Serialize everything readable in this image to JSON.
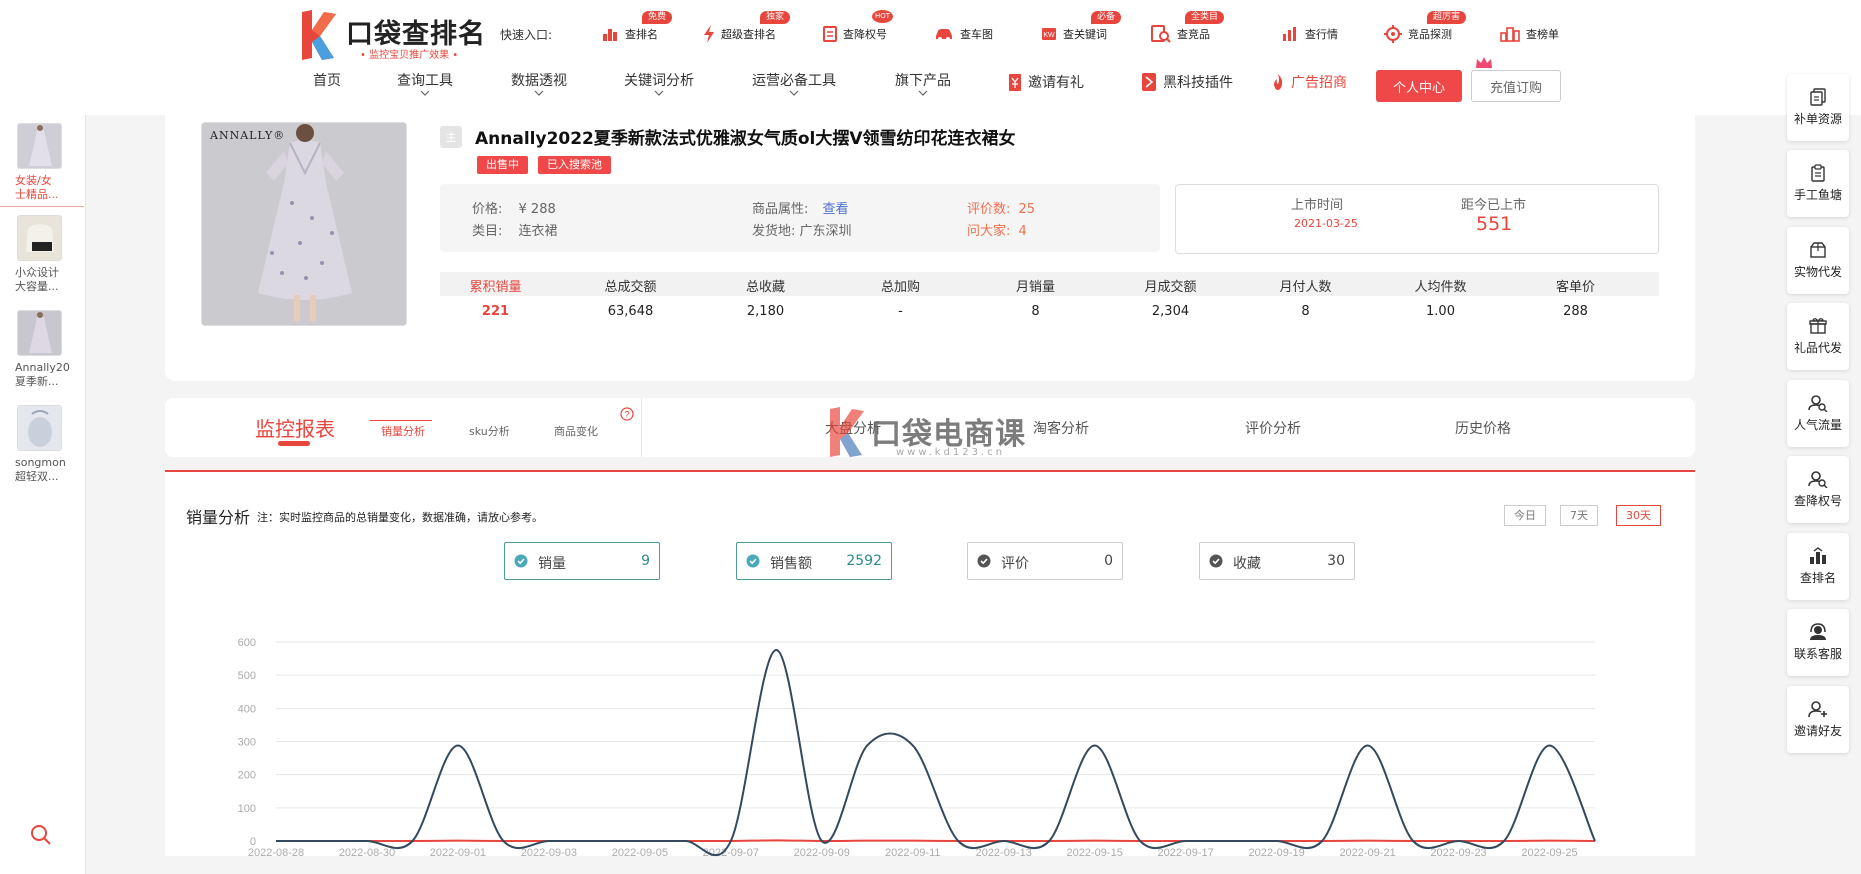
{
  "header": {
    "logo_title": "口袋查排名",
    "logo_subtitle": "• 监控宝贝推广效果 •",
    "quick_entry_label": "快速入口:",
    "quick_links": [
      {
        "label": "查排名",
        "tag": "免费",
        "icon": "rank-icon"
      },
      {
        "label": "超级查排名",
        "tag": "独家",
        "icon": "lightning-icon"
      },
      {
        "label": "查降权号",
        "tag": "HOT",
        "icon": "document-icon"
      },
      {
        "label": "查车图",
        "tag": "",
        "icon": "car-icon"
      },
      {
        "label": "查关键词",
        "tag": "必备",
        "icon": "keyword-icon"
      },
      {
        "label": "查竞品",
        "tag": "全类目",
        "icon": "search-document-icon"
      },
      {
        "label": "查行情",
        "tag": "",
        "icon": "bar-chart-icon"
      },
      {
        "label": "竞品探测",
        "tag": "超厉害",
        "icon": "target-icon"
      },
      {
        "label": "查榜单",
        "tag": "",
        "icon": "ranking-board-icon"
      }
    ],
    "nav": [
      "首页",
      "查询工具",
      "数据透视",
      "关键词分析",
      "运营必备工具",
      "旗下产品"
    ],
    "nav_special": [
      {
        "label": "邀请有礼",
        "icon": "gift-tag-icon",
        "color": "#333333"
      },
      {
        "label": "黑科技插件",
        "icon": "plugin-icon",
        "color": "#333333"
      },
      {
        "label": "广告招商",
        "icon": "ad-flame-icon",
        "color": "#e8453c"
      }
    ],
    "personal_center": "个人中心",
    "recharge": "充值订购"
  },
  "left_sidebar": {
    "items": [
      {
        "text": "女装/女士精品...",
        "line1": "女装/女",
        "line2": "士精品...",
        "active": true
      },
      {
        "text": "小众设计大容量...",
        "line1": "小众设计",
        "line2": "大容量...",
        "active": false
      },
      {
        "text": "Annally2022夏季新...",
        "line1": "Annally20",
        "line2": "夏季新...",
        "active": false
      },
      {
        "text": "songmont超轻双...",
        "line1": "songmon",
        "line2": "超轻双...",
        "active": false
      }
    ]
  },
  "right_sidebar": {
    "items": [
      {
        "label": "补单资源",
        "icon": "copy-icon"
      },
      {
        "label": "手工鱼塘",
        "icon": "clipboard-icon"
      },
      {
        "label": "实物代发",
        "icon": "package-icon"
      },
      {
        "label": "礼品代发",
        "icon": "gift-icon"
      },
      {
        "label": "人气流量",
        "icon": "user-search-icon"
      },
      {
        "label": "查降权号",
        "icon": "user-search-icon"
      },
      {
        "label": "查排名",
        "icon": "rank-icon"
      },
      {
        "label": "联系客服",
        "icon": "headset-icon"
      },
      {
        "label": "邀请好友",
        "icon": "add-user-icon"
      }
    ]
  },
  "product": {
    "brand": "ANNALLY®",
    "main_badge": "主",
    "title": "Annally2022夏季新款法式优雅淑女气质ol大摆V领雪纺印花连衣裙女",
    "tags": [
      "出售中",
      "已入搜索池"
    ],
    "price_label": "价格:",
    "price": "¥ 288",
    "attr_label": "商品属性:",
    "attr_link": "查看",
    "review_label": "评价数:",
    "review_count": "25",
    "category_label": "类目:",
    "category": "连衣裙",
    "ship_label": "发货地:",
    "ship_from": "广东深圳",
    "ask_label": "问大家:",
    "ask_count": "4",
    "launch_label": "上市时间",
    "launch_date": "2021-03-25",
    "since_label": "距今已上市",
    "since_days": "551",
    "stats": [
      {
        "label": "累积销量",
        "value": "221",
        "highlight": true
      },
      {
        "label": "总成交额",
        "value": "63,648",
        "highlight": false
      },
      {
        "label": "总收藏",
        "value": "2,180",
        "highlight": false
      },
      {
        "label": "总加购",
        "value": "-",
        "highlight": false
      },
      {
        "label": "月销量",
        "value": "8",
        "highlight": false
      },
      {
        "label": "月成交额",
        "value": "2,304",
        "highlight": false
      },
      {
        "label": "月付人数",
        "value": "8",
        "highlight": false
      },
      {
        "label": "人均件数",
        "value": "1.00",
        "highlight": false
      },
      {
        "label": "客单价",
        "value": "288",
        "highlight": false
      }
    ]
  },
  "tabs": {
    "main": "监控报表",
    "sub": [
      "销量分析",
      "sku分析",
      "商品变化"
    ],
    "big": [
      "大盘分析",
      "淘客分析",
      "评价分析",
      "历史价格"
    ]
  },
  "watermark": {
    "text": "口袋电商课",
    "url": "www.kd123.cn"
  },
  "sales": {
    "title": "销量分析",
    "note": "注：实时监控商品的总销量变化，数据准确，请放心参考。",
    "ranges": [
      {
        "label": "今日",
        "active": false
      },
      {
        "label": "7天",
        "active": false
      },
      {
        "label": "30天",
        "active": true
      }
    ],
    "metrics": [
      {
        "label": "销量",
        "value": "9",
        "on": true
      },
      {
        "label": "销售额",
        "value": "2592",
        "on": true
      },
      {
        "label": "评价",
        "value": "0",
        "on": false
      },
      {
        "label": "收藏",
        "value": "30",
        "on": false
      }
    ]
  },
  "chart_data": {
    "type": "line",
    "x": [
      "2022-08-28",
      "2022-08-29",
      "2022-08-30",
      "2022-08-31",
      "2022-09-01",
      "2022-09-02",
      "2022-09-03",
      "2022-09-04",
      "2022-09-05",
      "2022-09-06",
      "2022-09-07",
      "2022-09-08",
      "2022-09-09",
      "2022-09-10",
      "2022-09-11",
      "2022-09-12",
      "2022-09-13",
      "2022-09-14",
      "2022-09-15",
      "2022-09-16",
      "2022-09-17",
      "2022-09-18",
      "2022-09-19",
      "2022-09-20",
      "2022-09-21",
      "2022-09-22",
      "2022-09-23",
      "2022-09-24",
      "2022-09-25",
      "2022-09-26"
    ],
    "x_tick_labels": [
      "2022-08-28",
      "2022-08-30",
      "2022-09-01",
      "2022-09-03",
      "2022-09-05",
      "2022-09-07",
      "2022-09-09",
      "2022-09-11",
      "2022-09-13",
      "2022-09-15",
      "2022-09-17",
      "2022-09-19",
      "2022-09-21",
      "2022-09-23",
      "2022-09-25"
    ],
    "series": [
      {
        "values": [
          0,
          0,
          0,
          0,
          288,
          0,
          0,
          0,
          0,
          0,
          0,
          576,
          0,
          288,
          288,
          0,
          0,
          0,
          288,
          0,
          0,
          0,
          0,
          0,
          288,
          0,
          0,
          0,
          288,
          0
        ],
        "color": "#34495e"
      },
      {
        "values": [
          0,
          0,
          0,
          0,
          1,
          0,
          0,
          0,
          0,
          0,
          0,
          2,
          0,
          1,
          1,
          0,
          0,
          0,
          1,
          0,
          0,
          0,
          0,
          0,
          1,
          0,
          0,
          0,
          1,
          0
        ],
        "color": "#e8453c"
      }
    ],
    "ylim": [
      0,
      600
    ],
    "y_ticks": [
      0,
      100,
      200,
      300,
      400,
      500,
      600
    ],
    "grid": true,
    "xlabel": "",
    "ylabel": "",
    "title": ""
  }
}
